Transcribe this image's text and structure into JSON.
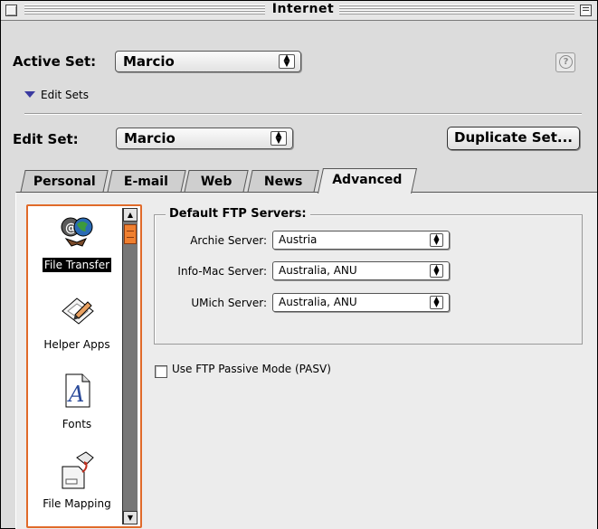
{
  "window": {
    "title": "Internet"
  },
  "active_set": {
    "label": "Active Set:",
    "value": "Marcio"
  },
  "edit_sets_disclosure": "Edit Sets",
  "edit_set": {
    "label": "Edit Set:",
    "value": "Marcio"
  },
  "duplicate_button": "Duplicate Set...",
  "help_glyph": "?",
  "tabs": [
    {
      "label": "Personal",
      "active": false
    },
    {
      "label": "E-mail",
      "active": false
    },
    {
      "label": "Web",
      "active": false
    },
    {
      "label": "News",
      "active": false
    },
    {
      "label": "Advanced",
      "active": true
    }
  ],
  "sidebar": {
    "items": [
      {
        "label": "File Transfer",
        "icon": "file-transfer-icon",
        "selected": true
      },
      {
        "label": "Helper Apps",
        "icon": "helper-apps-icon",
        "selected": false
      },
      {
        "label": "Fonts",
        "icon": "fonts-icon",
        "selected": false
      },
      {
        "label": "File Mapping",
        "icon": "file-mapping-icon",
        "selected": false
      }
    ]
  },
  "ftp_group": {
    "title": "Default FTP Servers:",
    "servers": [
      {
        "label": "Archie Server:",
        "value": "Austria"
      },
      {
        "label": "Info-Mac Server:",
        "value": "Australia, ANU"
      },
      {
        "label": "UMich Server:",
        "value": "Australia, ANU"
      }
    ]
  },
  "passive_mode": {
    "label": "Use FTP Passive Mode (PASV)",
    "checked": false
  },
  "colors": {
    "selection_accent": "#e06a2a",
    "window_bg": "#dcdcdc",
    "panel_bg": "#ececec"
  }
}
